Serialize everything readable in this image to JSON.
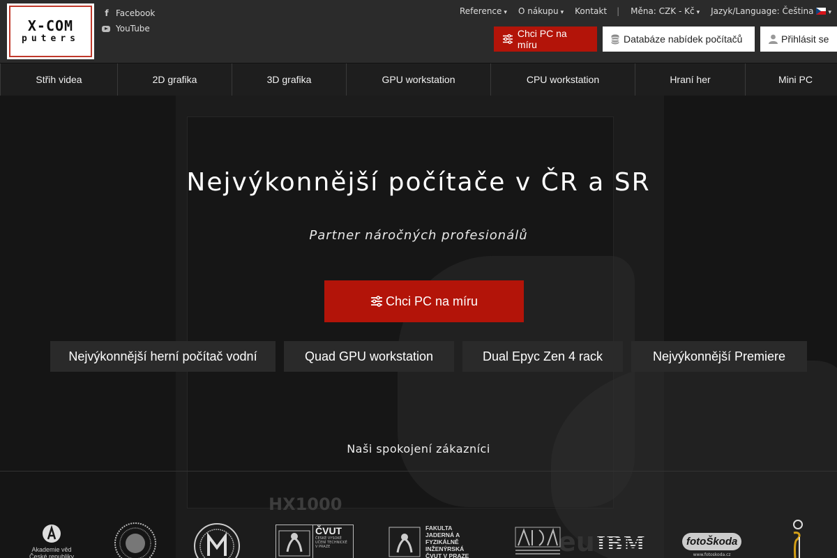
{
  "logo": {
    "line1": "X-COM",
    "line2": "puters"
  },
  "social": [
    {
      "label": "Facebook",
      "icon": "facebook-icon"
    },
    {
      "label": "YouTube",
      "icon": "youtube-icon"
    }
  ],
  "topmenu": {
    "reference": "Reference",
    "onakupu": "O nákupu",
    "kontakt": "Kontakt",
    "currency": "Měna: CZK - Kč",
    "language": "Jazyk/Language: Čeština",
    "caret": "▾"
  },
  "header_buttons": {
    "configure": "Chci PC na míru",
    "database": "Databáze nabídek počítačů",
    "login": "Přihlásit se"
  },
  "nav": [
    "Střih videa",
    "2D grafika",
    "3D grafika",
    "GPU workstation",
    "CPU workstation",
    "Hraní her",
    "Mini PC"
  ],
  "hero": {
    "title": "Nejvýkonnější počítače v ČR a SR",
    "subtitle": "Partner náročných profesionálů",
    "cta": "Chci PC na míru",
    "psu_text": "HX1000",
    "bg_text": "eu"
  },
  "featured": [
    "Nejvýkonnější herní počítač vodní",
    "Quad GPU workstation",
    "Dual Epyc Zen 4 rack",
    "Nejvýkonnější Premiere"
  ],
  "customers": {
    "label": "Naši spokojení zákazníci",
    "logos": {
      "akademie": "Akademie věd České republiky",
      "cvut": "ČVUT",
      "cvut_small": "ČESKÉ VYSOKÉ UČENÍ TECHNICKÉ V PRAZE",
      "fjfi": "FAKULTA JADERNÁ A FYZIKÁLNĚ INŽENÝRSKÁ ČVUT V PRAZE",
      "ibm": "IBM",
      "fotoskoda": "fotoŠkoda",
      "fotoskoda_url": "www.fotoskoda.cz"
    }
  },
  "colors": {
    "accent": "#b31409",
    "header_bg": "#2b2b2b",
    "nav_bg": "#1e1e1e"
  }
}
